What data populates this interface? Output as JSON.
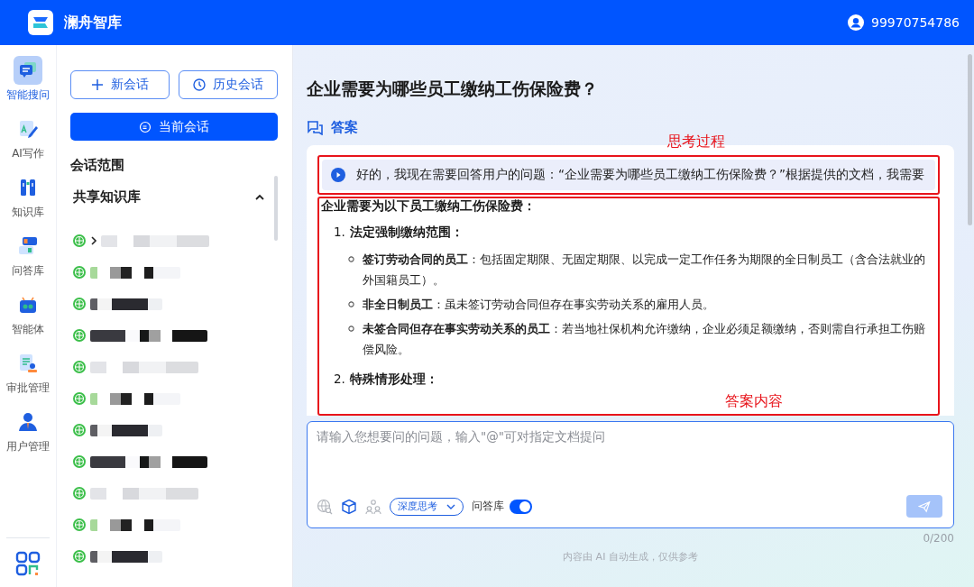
{
  "header": {
    "app_name": "澜舟智库",
    "user": "99970754786"
  },
  "rail": [
    {
      "kind": "search",
      "label": "智能搜问",
      "selected": true
    },
    {
      "kind": "write",
      "label": "AI写作",
      "selected": false
    },
    {
      "kind": "library",
      "label": "知识库",
      "selected": false
    },
    {
      "kind": "qa",
      "label": "问答库",
      "selected": false
    },
    {
      "kind": "agent",
      "label": "智能体",
      "selected": false
    },
    {
      "kind": "approval",
      "label": "审批管理",
      "selected": false
    },
    {
      "kind": "user",
      "label": "用户管理",
      "selected": false
    }
  ],
  "sidebar": {
    "new_chat": "新会话",
    "history": "历史会话",
    "current": "当前会话",
    "scope_title": "会话范围",
    "group": {
      "title": "共享知识库",
      "expanded": true,
      "items": [
        {
          "expandable": true
        },
        {
          "expandable": false
        },
        {
          "expandable": false
        },
        {
          "expandable": false
        },
        {
          "expandable": false
        },
        {
          "expandable": false
        },
        {
          "expandable": false
        },
        {
          "expandable": false
        },
        {
          "expandable": false
        },
        {
          "expandable": false
        },
        {
          "expandable": false
        }
      ]
    }
  },
  "question": "企业需要为哪些员工缴纳工伤保险费？",
  "answer_label": "答案",
  "thinking": {
    "label": "思考过程",
    "text": "好的，我现在需要回答用户的问题：“企业需要为哪些员工缴纳工伤保险费？”根据提供的文档，我需要"
  },
  "answer": {
    "label": "答案内容",
    "intro": "企业需要为以下员工缴纳工伤保险费：",
    "sections": [
      {
        "number": "1.",
        "title": "法定强制缴纳范围：",
        "items": [
          {
            "term": "签订劳动合同的员工",
            "text": "：包括固定期限、无固定期限、以完成一定工作任务为期限的全日制员工（含合法就业的外国籍员工）。"
          },
          {
            "term": "非全日制员工",
            "text": "：虽未签订劳动合同但存在事实劳动关系的雇用人员。"
          },
          {
            "term": "未签合同但存在事实劳动关系的员工",
            "text": "：若当地社保机构允许缴纳，企业必须足额缴纳，否则需自行承担工伤赔偿风险。"
          }
        ]
      },
      {
        "number": "2.",
        "title": "特殊情形处理："
      }
    ]
  },
  "input": {
    "placeholder": "请输入您想要问的问题，输入\"@\"可对指定文档提问",
    "web_search_on": false,
    "kb_on": true,
    "mode": "深度思考",
    "qa_label": "问答库",
    "qa_on": true,
    "send_disabled": true,
    "counter": "0/200"
  },
  "footer": "内容由 AI 自动生成，仅供参考"
}
